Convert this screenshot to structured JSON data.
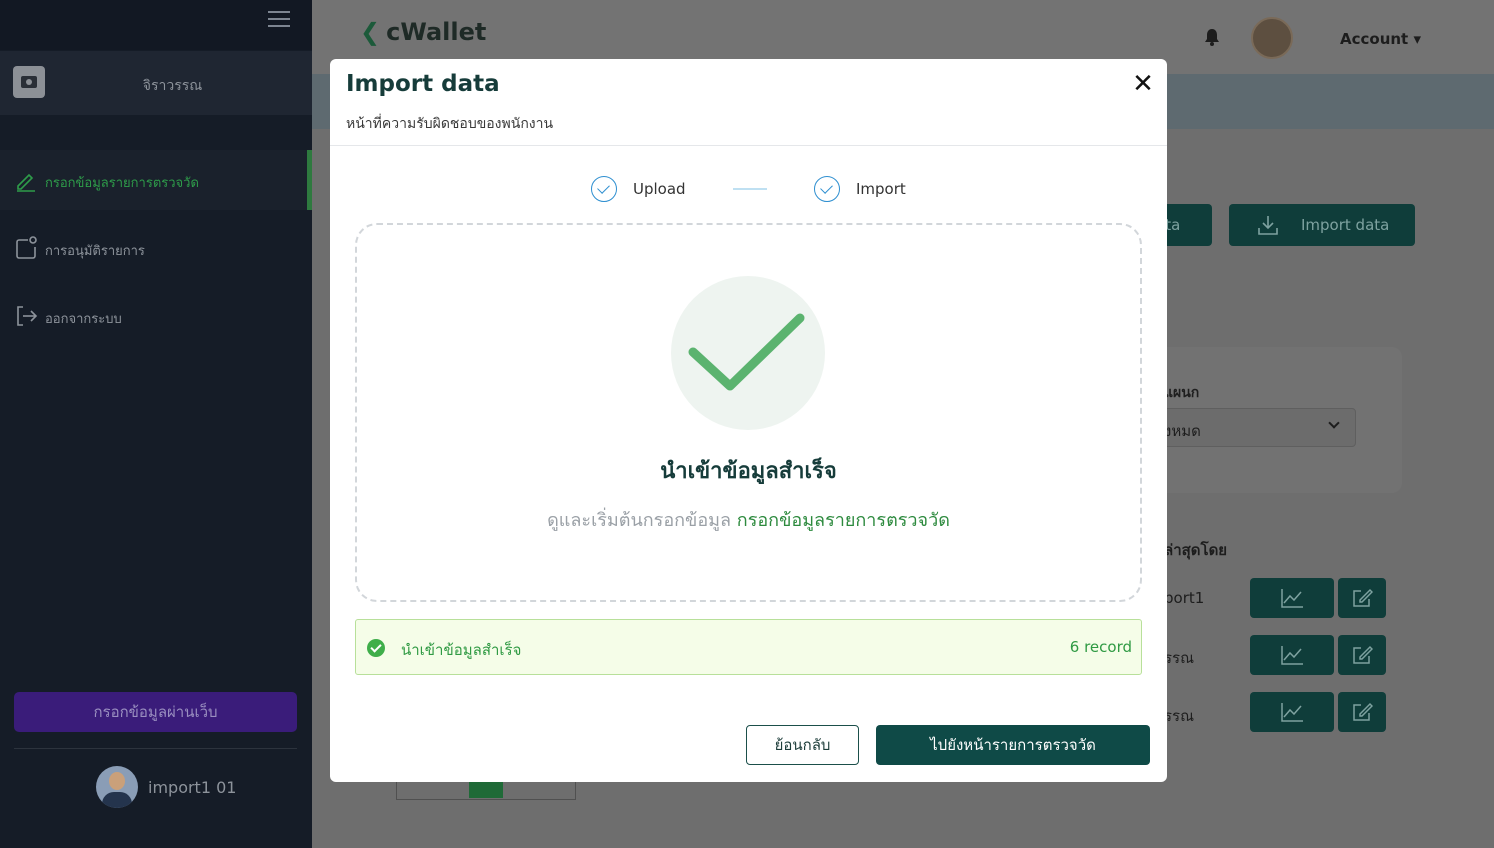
{
  "sidebar": {
    "username": "จิราวรรณ",
    "menu": [
      {
        "label": "กรอกข้อมูลรายการตรวจวัด",
        "icon": "edit-icon",
        "active": true
      },
      {
        "label": "การอนุมัติรายการ",
        "icon": "approval-icon",
        "active": false
      },
      {
        "label": "ออกจากระบบ",
        "icon": "logout-icon",
        "active": false
      }
    ],
    "web_entry_button": "กรอกข้อมูลผ่านเว็บ",
    "footer_user": "import1 01"
  },
  "header": {
    "brand": "cWallet",
    "account_label": "Account"
  },
  "background": {
    "btn_export_partial": "ata",
    "btn_import": "Import data",
    "filter_label_partial": "แผนก",
    "filter_value_partial": "ั้งหมด",
    "col_header_partial": "ล่าสุดโดย",
    "rows": [
      "port1",
      "รรณ",
      "รรณ"
    ]
  },
  "modal": {
    "title": "Import data",
    "subtitle": "หน้าที่ความรับผิดชอบของพนักงาน",
    "steps": [
      {
        "label": "Upload",
        "done": true
      },
      {
        "label": "Import",
        "done": true
      }
    ],
    "success_title": "นำเข้าข้อมูลสำเร็จ",
    "success_text": "ดูและเริ่มต้นกรอกข้อมูล",
    "success_link": "กรอกข้อมูลรายการตรวจวัด",
    "alert": {
      "text": "นำเข้าข้อมูลสำเร็จ",
      "count": "6 record"
    },
    "btn_back": "ย้อนกลับ",
    "btn_go": "ไปยังหน้ารายการตรวจวัด"
  },
  "colors": {
    "brand_dark": "#163c3a",
    "success_green": "#2f9a43",
    "step_blue": "#2e8fd0"
  }
}
